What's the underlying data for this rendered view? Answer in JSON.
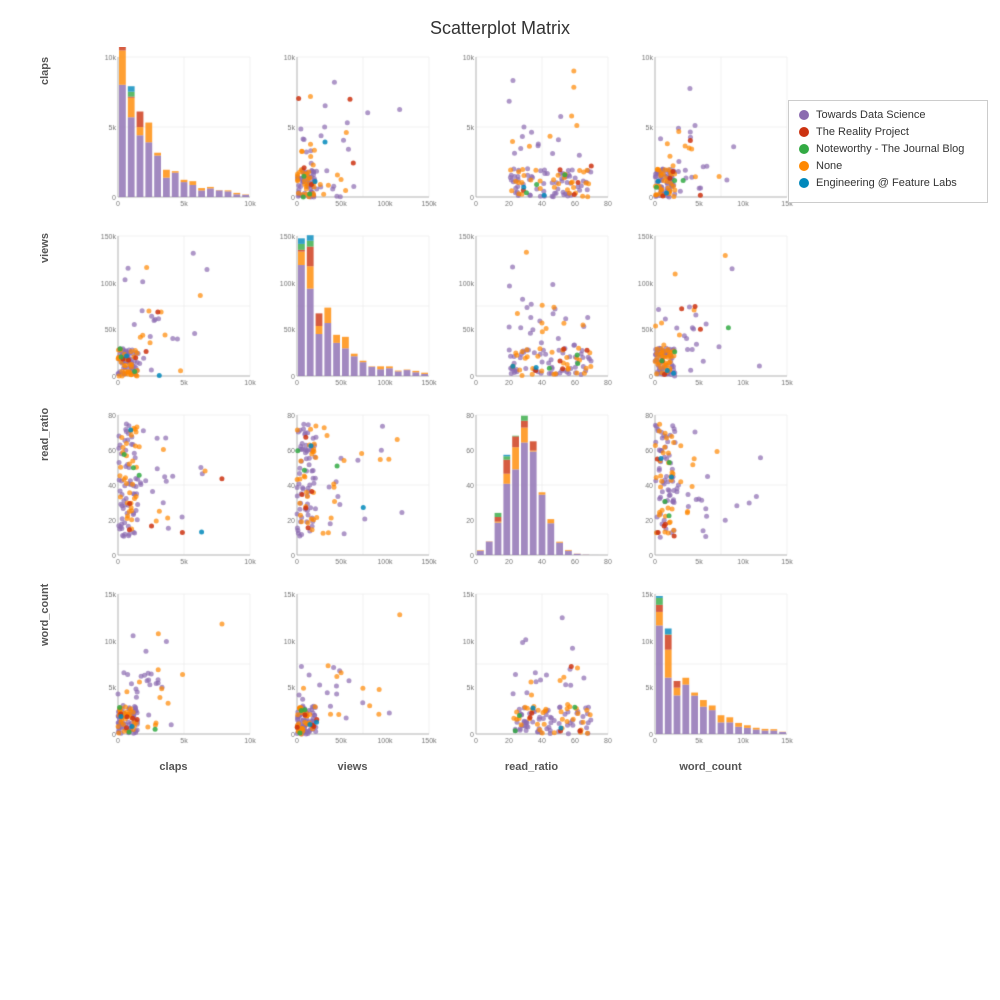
{
  "title": "Scatterplot Matrix",
  "axes": [
    "claps",
    "views",
    "read_ratio",
    "word_count"
  ],
  "legend": {
    "items": [
      {
        "label": "Towards Data Science",
        "color": "#8B6BB0",
        "shape": "circle"
      },
      {
        "label": "The Reality Project",
        "color": "#CC3311",
        "shape": "circle"
      },
      {
        "label": "Noteworthy - The Journal Blog",
        "color": "#33AA44",
        "shape": "circle"
      },
      {
        "label": "None",
        "color": "#FF8800",
        "shape": "circle"
      },
      {
        "label": "Engineering @ Feature Labs",
        "color": "#0088BB",
        "shape": "circle"
      }
    ]
  },
  "colors": {
    "tds": "#8B6BB0",
    "trp": "#CC3311",
    "ntjb": "#33AA44",
    "none": "#FF8800",
    "efl": "#0088BB"
  }
}
